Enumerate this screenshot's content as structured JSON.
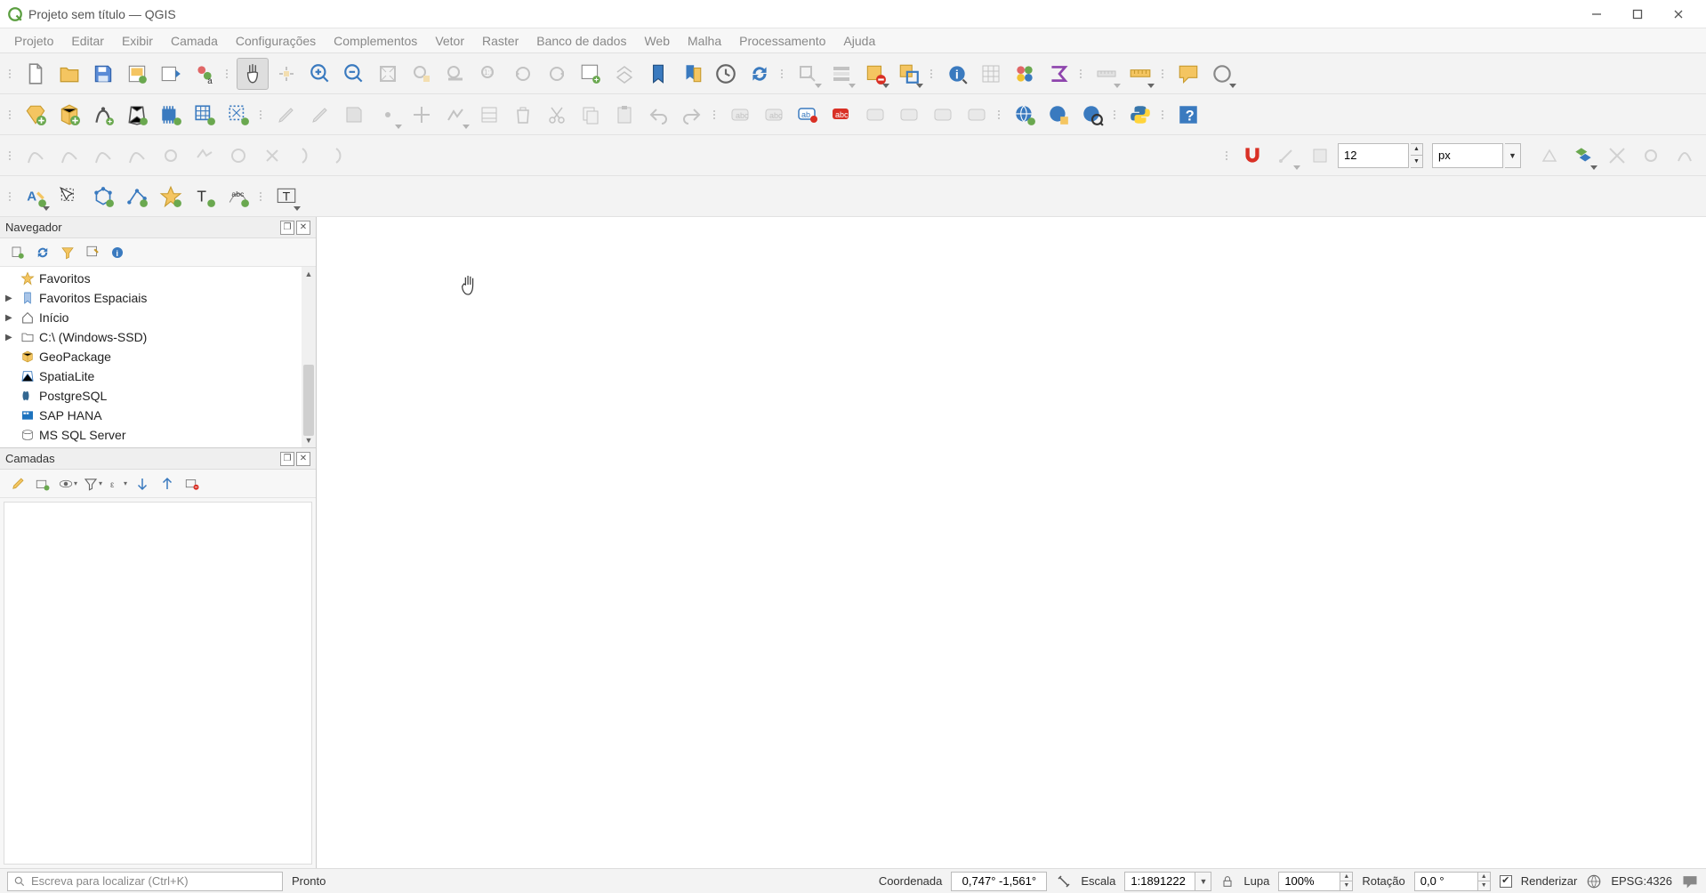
{
  "window": {
    "title": "Projeto sem título — QGIS"
  },
  "menu": {
    "items": [
      {
        "label": "Projeto"
      },
      {
        "label": "Editar"
      },
      {
        "label": "Exibir"
      },
      {
        "label": "Camada"
      },
      {
        "label": "Configurações"
      },
      {
        "label": "Complementos"
      },
      {
        "label": "Vetor"
      },
      {
        "label": "Raster"
      },
      {
        "label": "Banco de dados"
      },
      {
        "label": "Web"
      },
      {
        "label": "Malha"
      },
      {
        "label": "Processamento"
      },
      {
        "label": "Ajuda"
      }
    ]
  },
  "snapping": {
    "value": "12",
    "unit": "px"
  },
  "browser": {
    "title": "Navegador",
    "items": [
      {
        "label": "Favoritos",
        "icon": "star",
        "expand": ""
      },
      {
        "label": "Favoritos Espaciais",
        "icon": "spatial-bookmark",
        "expand": "▶"
      },
      {
        "label": "Início",
        "icon": "home",
        "expand": "▶"
      },
      {
        "label": "C:\\ (Windows-SSD)",
        "icon": "folder",
        "expand": "▶"
      },
      {
        "label": "GeoPackage",
        "icon": "geopackage",
        "expand": ""
      },
      {
        "label": "SpatiaLite",
        "icon": "spatialite",
        "expand": ""
      },
      {
        "label": "PostgreSQL",
        "icon": "postgres",
        "expand": ""
      },
      {
        "label": "SAP HANA",
        "icon": "hana",
        "expand": ""
      },
      {
        "label": "MS SQL Server",
        "icon": "mssql",
        "expand": ""
      }
    ]
  },
  "layers": {
    "title": "Camadas"
  },
  "status": {
    "locator_placeholder": "Escreva para localizar (Ctrl+K)",
    "ready": "Pronto",
    "coord_label": "Coordenada",
    "coord_value": "0,747° -1,561°",
    "scale_label": "Escala",
    "scale_value": "1:1891222",
    "lupa_label": "Lupa",
    "lupa_value": "100%",
    "rotation_label": "Rotação",
    "rotation_value": "0,0 °",
    "render_label": "Renderizar",
    "crs_label": "EPSG:4326"
  }
}
